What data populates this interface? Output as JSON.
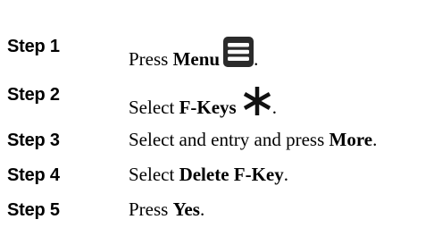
{
  "steps": [
    {
      "label": "Step 1",
      "parts": {
        "text1": "Press ",
        "bold1": "Menu",
        "suffix": "."
      },
      "icon": "menu-icon"
    },
    {
      "label": "Step 2",
      "parts": {
        "text1": "Select ",
        "bold1": "F-Keys",
        "suffix": "."
      },
      "icon": "asterisk-icon"
    },
    {
      "label": "Step 3",
      "parts": {
        "text1": "Select and entry and press ",
        "bold1": "More",
        "suffix": "."
      }
    },
    {
      "label": "Step 4",
      "parts": {
        "text1": "Select ",
        "bold1": "Delete F-Key",
        "suffix": "."
      }
    },
    {
      "label": "Step 5",
      "parts": {
        "text1": "Press ",
        "bold1": "Yes",
        "suffix": "."
      }
    }
  ]
}
